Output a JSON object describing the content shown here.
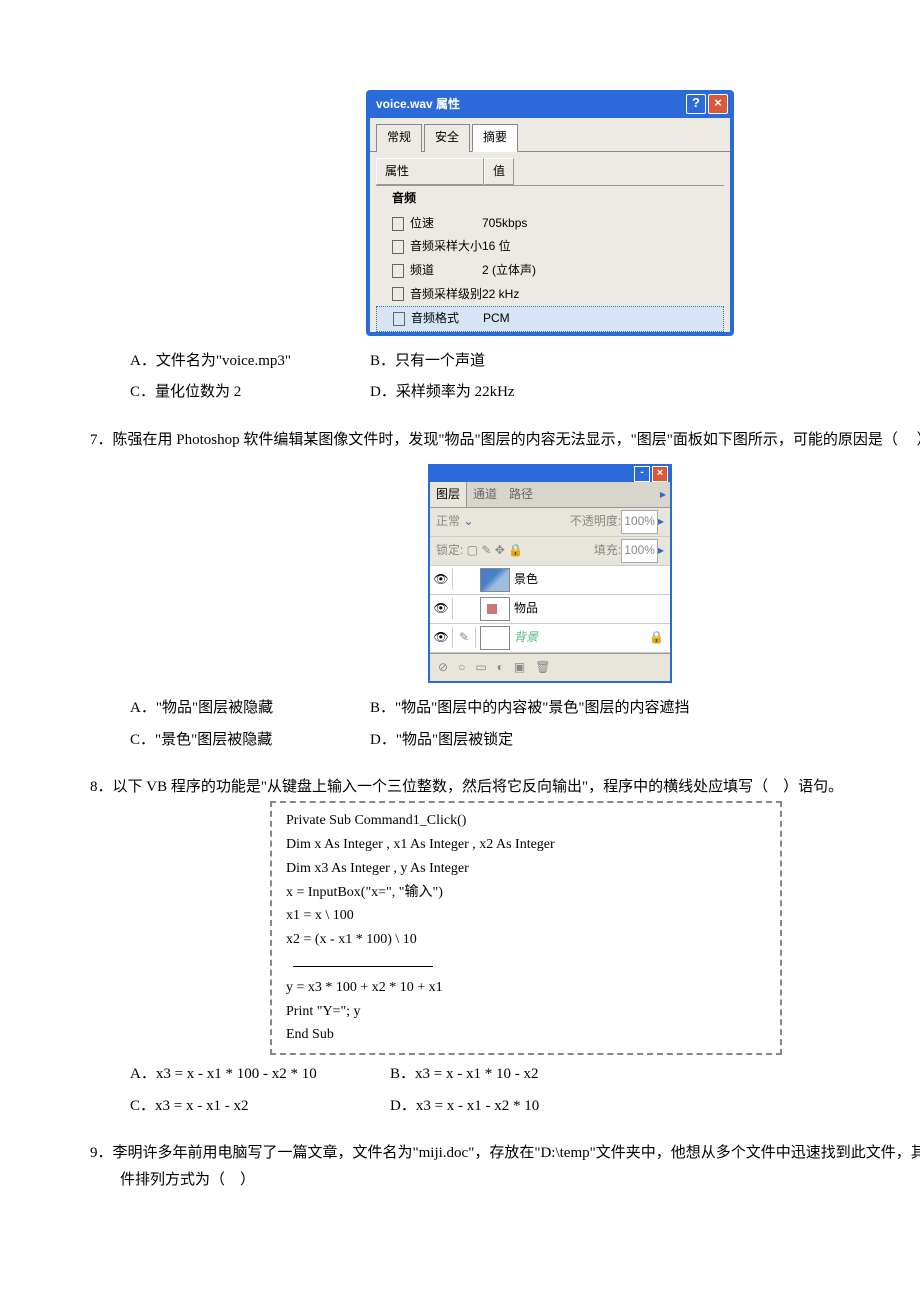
{
  "dlg": {
    "title": "voice.wav 属性",
    "tabs": [
      "常规",
      "安全",
      "摘要"
    ],
    "headers": {
      "prop": "属性",
      "val": "值"
    },
    "category": "音频",
    "rows": [
      {
        "k": "位速",
        "v": "705kbps"
      },
      {
        "k": "音频采样大小",
        "v": "16 位"
      },
      {
        "k": "频道",
        "v": "2 (立体声)"
      },
      {
        "k": "音频采样级别",
        "v": "22 kHz"
      },
      {
        "k": "音频格式",
        "v": "PCM"
      }
    ]
  },
  "q6": {
    "A": "A．文件名为\"voice.mp3\"",
    "B": "B．只有一个声道",
    "C": "C．量化位数为 2",
    "D": "D．采样频率为 22kHz"
  },
  "q7": {
    "text": "7．陈强在用 Photoshop 软件编辑某图像文件时，发现\"物品\"图层的内容无法显示，\"图层\"面板如下图所示，可能的原因是（　 ）",
    "A": "A．\"物品\"图层被隐藏",
    "B": "B．\"物品\"图层中的内容被\"景色\"图层的内容遮挡",
    "C": "C．\"景色\"图层被隐藏",
    "D": "D．\"物品\"图层被锁定"
  },
  "ps": {
    "tabs": [
      "图层",
      "通道",
      "路径"
    ],
    "mode": "正常",
    "opLabel": "不透明度:",
    "opVal": "100%",
    "lockLabel": "锁定:",
    "fillLabel": "填充:",
    "fillVal": "100%",
    "layers": [
      {
        "name": "景色",
        "cls": "j"
      },
      {
        "name": "物品",
        "cls": "w"
      },
      {
        "name": "背景",
        "cls": "b",
        "bg": true
      }
    ]
  },
  "q8": {
    "text": "8．以下 VB 程序的功能是\"从键盘上输入一个三位整数，然后将它反向输出\"，程序中的横线处应填写（　）语句。",
    "code": [
      "Private Sub Command1_Click()",
      "  Dim   x   As Integer ,   x1   As   Integer ,   x2   As   Integer",
      "  Dim   x3   As Integer ,   y   As   Integer",
      "  x = InputBox(\"x=\", \"输入\")",
      "  x1 = x \\ 100",
      "  x2 = (x - x1 * 100) \\ 10",
      "  ____",
      "  y = x3 * 100 + x2 * 10 + x1",
      "  Print \"Y=\"; y",
      "End Sub"
    ],
    "A": "A．x3 = x - x1 * 100 - x2 * 10",
    "B": "B．x3 = x - x1 * 10 - x2",
    "C": "C．x3 = x - x1 - x2",
    "D": "D．x3 = x - x1 - x2 * 10"
  },
  "q9": {
    "text": "9．李明许多年前用电脑写了一篇文章，文件名为\"miji.doc\"，存放在\"D:\\temp\"文件夹中，他想从多个文件中迅速找到此文件，其应选择的文件排列方式为（　）"
  }
}
